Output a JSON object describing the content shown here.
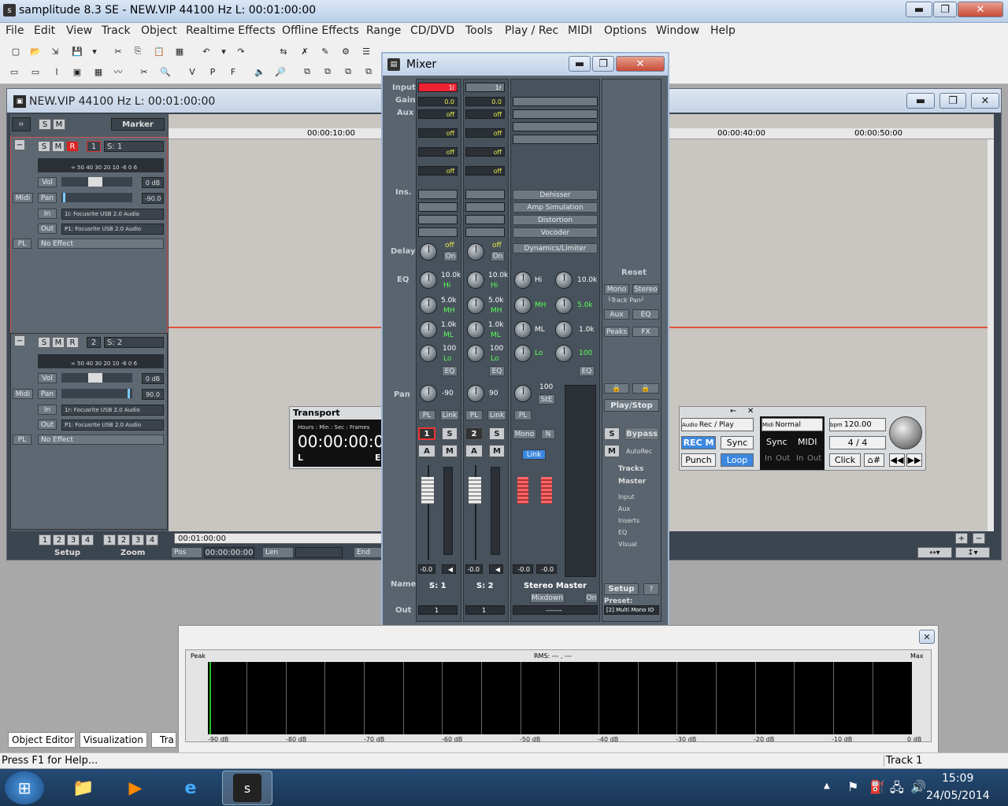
{
  "app": {
    "title": "samplitude 8.3 SE  - NEW.VIP   44100 Hz L: 00:01:00:00",
    "minimize": "▬",
    "maximize": "❐",
    "close": "✕"
  },
  "menu": [
    "File",
    "Edit",
    "View",
    "Track",
    "Object",
    "Realtime Effects",
    "Offline Effects",
    "Range",
    "CD/DVD",
    "Tools",
    "Play / Rec",
    "MIDI",
    "Options",
    "Window",
    "Help"
  ],
  "vip": {
    "title": "NEW.VIP   44100 Hz L: 00:01:00:00",
    "marker_label": "Marker",
    "track1": {
      "solo": "S",
      "mute": "M",
      "rec": "R",
      "number": "1",
      "name": "S: 1",
      "vol_label": "Vol",
      "vol_value": "0 dB",
      "pan_label": "Pan",
      "pan_value": "-90.0",
      "midi_label": "Midi",
      "in_label": "In",
      "in_value": "1I: Focusrite USB 2.0 Audio",
      "out_label": "Out",
      "out_value": "P1: Focusrite USB 2.0 Audio",
      "pl_label": "PL",
      "effect_value": "No Effect",
      "meter_scale": "∞  50 40 30 20  10 -6   0   6"
    },
    "track2": {
      "solo": "S",
      "mute": "M",
      "rec": "R",
      "number": "2",
      "name": "S: 2",
      "vol_label": "Vol",
      "vol_value": "0 dB",
      "pan_label": "Pan",
      "pan_value": "90.0",
      "midi_label": "Midi",
      "in_label": "In",
      "in_value": "1r: Focusrite USB 2.0 Audio",
      "out_label": "Out",
      "out_value": "P1: Focusrite USB 2.0 Audio",
      "pl_label": "PL",
      "effect_value": "No Effect",
      "meter_scale": "∞  50 40 30 20  10 -6   0   6"
    },
    "ruler": [
      "00:00:10:00",
      "00:00:40:00",
      "00:00:50:00"
    ],
    "setup_label": "Setup",
    "zoom_label": "Zoom",
    "setup_nums": [
      "1",
      "2",
      "3",
      "4"
    ],
    "zoom_nums": [
      "1",
      "2",
      "3",
      "4"
    ],
    "position_time": "00:01:00:00",
    "pos_label": "Pos",
    "pos_value": "00:00:00:00",
    "len_label": "Len",
    "end_label": "End"
  },
  "mixer": {
    "title": "Mixer",
    "labels": {
      "input": "Input",
      "gain": "Gain",
      "aux": "Aux",
      "ins": "Ins.",
      "delay": "Delay",
      "eq": "EQ",
      "pan": "Pan",
      "name": "Name",
      "out": "Out"
    },
    "ch1": {
      "input": "1l",
      "gain": "0.0",
      "aux": [
        "off",
        "off",
        "off",
        "off"
      ],
      "delay_off": "off",
      "delay_on": "On",
      "eq": [
        "10.0k",
        "Hi",
        "5.0k",
        "MH",
        "1.0k",
        "ML",
        "100",
        "Lo"
      ],
      "eq_btn": "EQ",
      "pan": "-90",
      "pl": "PL",
      "link": "Link",
      "num": "1",
      "solo": "S",
      "a": "A",
      "m": "M",
      "fader": "-0.0",
      "name": "S: 1",
      "out": "1"
    },
    "ch2": {
      "input": "1r",
      "gain": "0.0",
      "aux": [
        "off",
        "off",
        "off",
        "off"
      ],
      "delay_off": "off",
      "delay_on": "On",
      "eq": [
        "10.0k",
        "Hi",
        "5.0k",
        "MH",
        "1.0k",
        "ML",
        "100",
        "Lo"
      ],
      "eq_btn": "EQ",
      "pan": "90",
      "pl": "PL",
      "link": "Link",
      "num": "2",
      "solo": "S",
      "a": "A",
      "m": "M",
      "fader": "-0.0",
      "name": "S: 2",
      "out": "1"
    },
    "master": {
      "inserts": [
        "Dehisser",
        "Amp Simulation",
        "Distortion",
        "Vocoder",
        "Dynamics/Limiter"
      ],
      "eq": [
        "Hi",
        "10.0k",
        "MH",
        "5.0k",
        "ML",
        "1.0k",
        "Lo",
        "100"
      ],
      "eq_btn": "EQ",
      "pan": "100",
      "ste": "StE",
      "pl": "PL",
      "mono": "Mono",
      "n": "N",
      "link": "Link",
      "fader_l": "-0.0",
      "fader_r": "-0.0",
      "name": "Stereo Master",
      "mixdown": "Mixdown",
      "on": "On",
      "out": "-------",
      "meter_scale": [
        "6",
        "0",
        "3",
        "6",
        "10",
        "20",
        "30",
        "40",
        "50",
        "60",
        "70"
      ]
    },
    "side": {
      "reset": "Reset",
      "mono": "Mono",
      "stereo": "Stereo",
      "track_pan": "└Track Pan┘",
      "aux": "Aux",
      "eq": "EQ",
      "peaks": "Peaks",
      "fx": "FX",
      "playstop": "Play/Stop",
      "s": "S",
      "bypass": "Bypass",
      "m": "M",
      "autorec": "AutoRec",
      "tracks": "Tracks",
      "master": "Master",
      "input": "Input",
      "aux2": "Aux",
      "inserts": "Inserts",
      "eq2": "EQ",
      "visual": "Visual",
      "setup": "Setup",
      "help": "?",
      "preset_label": "Preset:",
      "preset_value": "[2] Multi Mono IO"
    }
  },
  "transport": {
    "title": "Transport",
    "format": "Hours :  Min  :  Sec  : Frames",
    "time": "00:00:00:00",
    "l": "L",
    "e": "E",
    "audio_label": "Audio",
    "recplay": "Rec / Play",
    "recm": "REC M",
    "sync": "Sync",
    "punch": "Punch",
    "loop": "Loop",
    "midi_label": "Midi",
    "midi_mode": "Normal",
    "sync2": "Sync",
    "midi2": "MIDI",
    "in1": "In",
    "out1": "Out",
    "in2": "In",
    "out2": "Out",
    "bpm_label": "bpm",
    "bpm": "120.00",
    "sig": "4 / 4",
    "click": "Click"
  },
  "peakmeter": {
    "peak_label": "Peak",
    "rms_label": "RMS:  ---  ,  ---",
    "max_label": "Max",
    "scale": [
      "-90 dB",
      "-80 dB",
      "-70 dB",
      "-60 dB",
      "-50 dB",
      "-40 dB",
      "-30 dB",
      "-20 dB",
      "-10 dB",
      "0 dB"
    ]
  },
  "tabs": [
    "Object Editor",
    "Visualization",
    "Tra"
  ],
  "status": {
    "help": "Press F1 for Help...",
    "track": "Track 1"
  },
  "clock": {
    "time": "15:09",
    "date": "24/05/2014"
  }
}
